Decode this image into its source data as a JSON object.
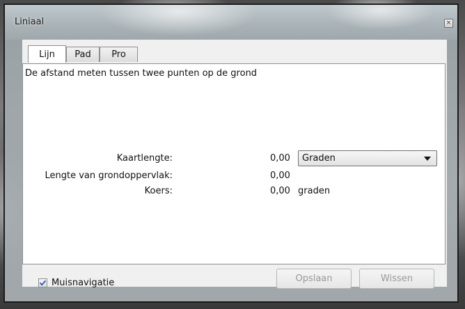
{
  "window": {
    "title": "Liniaal",
    "close_glyph": "×"
  },
  "tabs": [
    {
      "label": "Lijn",
      "active": true
    },
    {
      "label": "Pad",
      "active": false
    },
    {
      "label": "Pro",
      "active": false
    }
  ],
  "panel": {
    "description": "De afstand meten tussen twee punten op de grond",
    "rows": [
      {
        "label": "Kaartlengte:",
        "value": "0,00"
      },
      {
        "label": "Lengte van grondoppervlak:",
        "value": "0,00"
      },
      {
        "label": "Koers:",
        "value": "0,00",
        "unit": "graden"
      }
    ],
    "unit_select": {
      "selected": "Graden"
    }
  },
  "footer": {
    "mouse_navigation_label": "Muisnavigatie",
    "mouse_navigation_checked": true,
    "save_label": "Opslaan",
    "clear_label": "Wissen"
  },
  "icons": [
    "close-icon",
    "checkmark-icon",
    "chevron-down-icon"
  ]
}
